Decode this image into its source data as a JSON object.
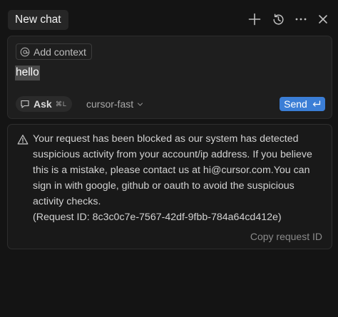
{
  "header": {
    "tab_title": "New chat",
    "icons": [
      "plus-icon",
      "history-icon",
      "more-icon",
      "close-icon"
    ]
  },
  "composer": {
    "add_context_label": "Add context",
    "message": "hello",
    "mode_label": "Ask",
    "mode_shortcut": "⌘L",
    "model_name": "cursor-fast",
    "send_label": "Send"
  },
  "error": {
    "lines": [
      "Your request has been blocked as our system has detected",
      "suspicious activity from your account/ip address. If you believe",
      "this is a mistake, please contact us at hi@cursor.com.You can",
      "sign in with google, github or oauth to avoid the suspicious",
      "activity checks.",
      "(Request ID: 8c3c0c7e-7567-42df-9fbb-784a64cd412e)"
    ],
    "copy_label": "Copy request ID"
  },
  "colors": {
    "background": "#141414",
    "send_button": "#3b7ed6",
    "panel": "#1e1e1e"
  }
}
